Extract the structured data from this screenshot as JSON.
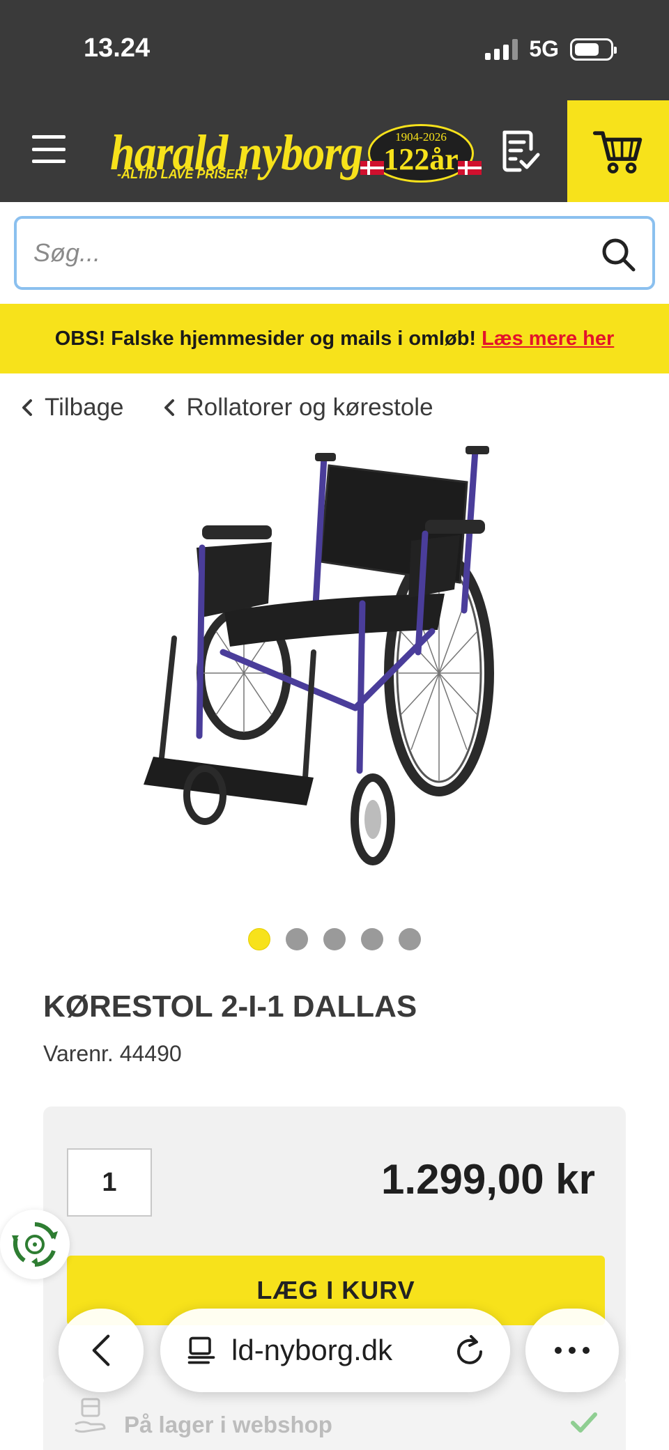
{
  "status_bar": {
    "time": "13.24",
    "network": "5G"
  },
  "header": {
    "logo_text": "harald nyborg",
    "logo_tagline": "-ALTID LAVE PRISER!",
    "badge_years": "1904-2026",
    "badge_anniversary": "122år"
  },
  "search": {
    "placeholder": "Søg..."
  },
  "notice": {
    "text": "OBS! Falske hjemmesider og mails i omløb!",
    "link": "Læs mere her"
  },
  "breadcrumb": {
    "back": "Tilbage",
    "category": "Rollatorer og kørestole"
  },
  "gallery": {
    "total_images": 5,
    "active_index": 0
  },
  "product": {
    "title": "KØRESTOL 2-I-1 DALLAS",
    "sku": "Varenr. 44490",
    "quantity": "1",
    "price": "1.299,00 kr",
    "add_to_cart": "LÆG I KURV",
    "stock_status": "På lager i webshop"
  },
  "browser": {
    "url_display": "ld-nyborg.dk"
  },
  "colors": {
    "brand_yellow": "#f7e21b",
    "header_dark": "#3a3a3a",
    "alert_red": "#e3132b",
    "stock_green": "#4caf50"
  }
}
